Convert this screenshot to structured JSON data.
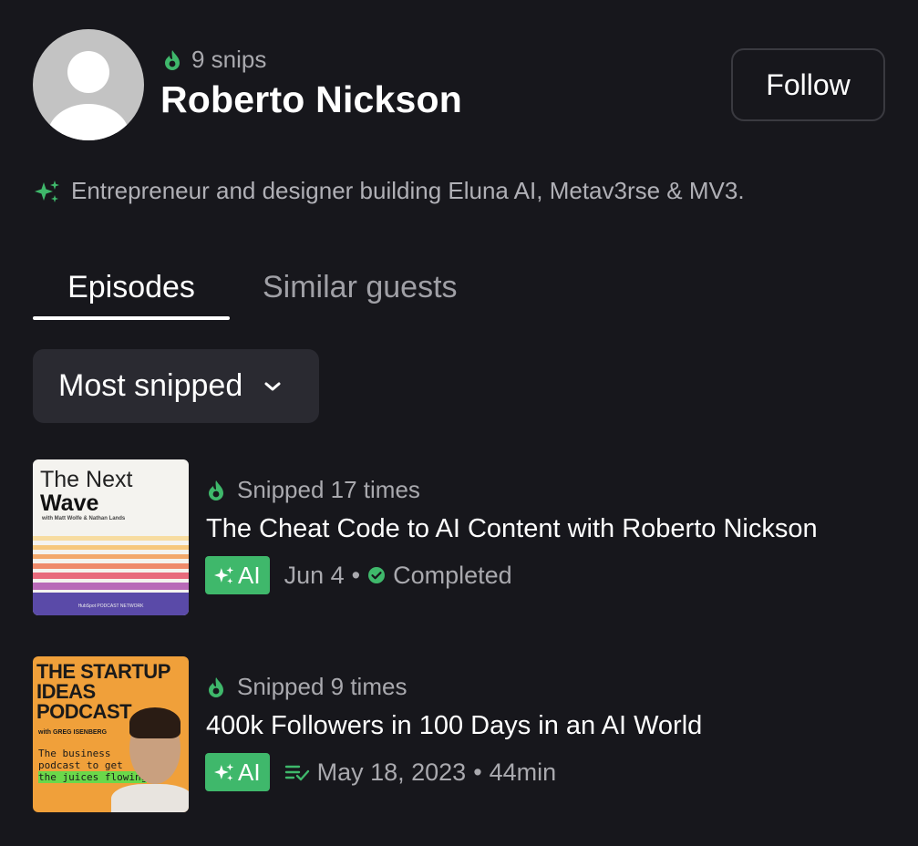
{
  "colors": {
    "background": "#17171c",
    "accent_green": "#3fb86b",
    "muted_text": "#a9a9ae"
  },
  "profile": {
    "snips": "9 snips",
    "name": "Roberto Nickson",
    "follow_label": "Follow",
    "bio": "Entrepreneur and designer building Eluna AI, Metav3rse & MV3."
  },
  "tabs": [
    {
      "label": "Episodes",
      "active": true
    },
    {
      "label": "Similar guests",
      "active": false
    }
  ],
  "sort": {
    "selected": "Most snipped"
  },
  "episodes": [
    {
      "snipped": "Snipped 17 times",
      "title": "The Cheat Code to AI Content with Roberto Nickson",
      "ai_label": "AI",
      "date": "Jun 4",
      "separator": "•",
      "status": "Completed",
      "status_icon": "check-circle-icon",
      "artwork": {
        "line1": "The Next",
        "line2": "Wave",
        "line3": "with Matt Wolfe & Nathan Lands",
        "network": "HubSpot PODCAST NETWORK"
      }
    },
    {
      "snipped": "Snipped 9 times",
      "title": "400k Followers in 100 Days in an AI World",
      "ai_label": "AI",
      "date": "May 18, 2023",
      "separator": "•",
      "duration": "44min",
      "status_icon": "queue-check-icon",
      "artwork": {
        "line1": "THE STARTUP",
        "line2": "IDEAS",
        "line3": "PODCAST",
        "host": "with GREG ISENBERG",
        "tag1": "The business",
        "tag2": "podcast to get",
        "tag3": "the juices flowing"
      }
    }
  ]
}
